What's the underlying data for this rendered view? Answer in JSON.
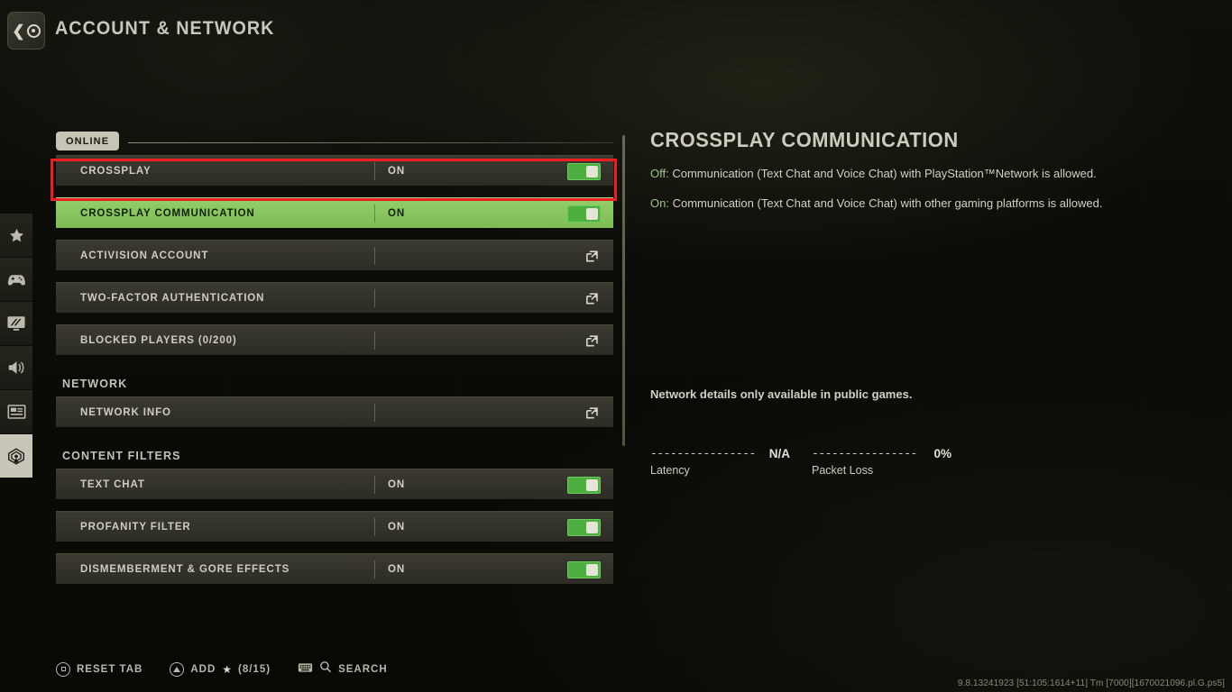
{
  "header": {
    "title": "ACCOUNT & NETWORK",
    "back_icon": "back-circle-icon"
  },
  "sidebar": {
    "items": [
      {
        "icon": "star-icon",
        "name": "favorites",
        "active": false
      },
      {
        "icon": "gamepad-icon",
        "name": "controller",
        "active": false
      },
      {
        "icon": "monitor-icon",
        "name": "graphics",
        "active": false
      },
      {
        "icon": "speaker-icon",
        "name": "audio",
        "active": false
      },
      {
        "icon": "interface-icon",
        "name": "interface",
        "active": false
      },
      {
        "icon": "antenna-icon",
        "name": "account-network",
        "active": true
      }
    ]
  },
  "settings": {
    "tab_label": "ONLINE",
    "groups": [
      {
        "header": null,
        "rows": [
          {
            "label": "CROSSPLAY",
            "value": "ON",
            "control": "toggle",
            "state": "on",
            "selected": false,
            "highlighted": true
          },
          {
            "label": "CROSSPLAY COMMUNICATION",
            "value": "ON",
            "control": "toggle",
            "state": "on",
            "selected": true,
            "highlighted": false
          },
          {
            "label": "ACTIVISION ACCOUNT",
            "value": "",
            "control": "external-link",
            "state": "",
            "selected": false,
            "highlighted": false
          },
          {
            "label": "TWO-FACTOR AUTHENTICATION",
            "value": "",
            "control": "external-link",
            "state": "",
            "selected": false,
            "highlighted": false
          },
          {
            "label": "BLOCKED PLAYERS (0/200)",
            "value": "",
            "control": "external-link",
            "state": "",
            "selected": false,
            "highlighted": false
          }
        ]
      },
      {
        "header": "NETWORK",
        "rows": [
          {
            "label": "NETWORK INFO",
            "value": "",
            "control": "external-link",
            "state": "",
            "selected": false,
            "highlighted": false
          }
        ]
      },
      {
        "header": "CONTENT FILTERS",
        "rows": [
          {
            "label": "TEXT CHAT",
            "value": "ON",
            "control": "toggle",
            "state": "on",
            "selected": false,
            "highlighted": false
          },
          {
            "label": "PROFANITY FILTER",
            "value": "ON",
            "control": "toggle",
            "state": "on",
            "selected": false,
            "highlighted": false
          },
          {
            "label": "DISMEMBERMENT & GORE EFFECTS",
            "value": "ON",
            "control": "toggle",
            "state": "on",
            "selected": false,
            "highlighted": false
          }
        ]
      }
    ]
  },
  "detail": {
    "title": "CROSSPLAY COMMUNICATION",
    "off_label": "Off:",
    "off_text": " Communication (Text Chat and Voice Chat) with PlayStation™Network is allowed.",
    "on_label": "On:",
    "on_text": " Communication (Text Chat and Voice Chat) with other gaming platforms is allowed.",
    "network_note": "Network details only available in public games.",
    "stats": [
      {
        "name": "Latency",
        "value": "N/A",
        "dashes": "----------------"
      },
      {
        "name": "Packet Loss",
        "value": "0%",
        "dashes": "----------------"
      }
    ]
  },
  "bottom_bar": {
    "reset_label": "RESET TAB",
    "add_label": "ADD",
    "add_count": "(8/15)",
    "search_label": "SEARCH",
    "star_glyph": "★"
  },
  "version_string": "9.8.13241923 [51:105:1614+11] Tm [7000][1670021096.pl.G.ps5]",
  "colors": {
    "accent_green": "#85c45c",
    "toggle_green": "#4caf3f",
    "highlight_red": "#ef1d20",
    "text_primary": "#cecbbe",
    "background": "#0a0b07"
  }
}
